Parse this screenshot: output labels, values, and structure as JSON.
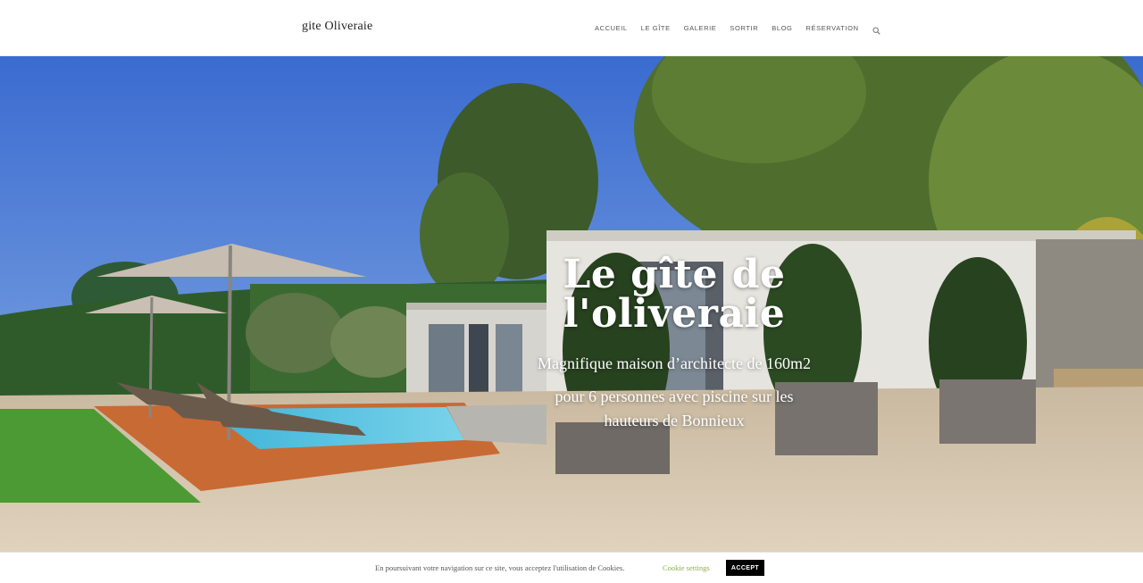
{
  "header": {
    "site_title": "gite Oliveraie",
    "nav": [
      {
        "label": "ACCUEIL"
      },
      {
        "label": "LE GÎTE"
      },
      {
        "label": "GALERIE"
      },
      {
        "label": "SORTIR"
      },
      {
        "label": "BLOG"
      },
      {
        "label": "RÉSERVATION"
      }
    ],
    "search_icon": "search-icon"
  },
  "hero": {
    "title_line1": "Le gîte de",
    "title_line2": "l'oliveraie",
    "subtitle_line1": "Magnifique maison d’architecte de 160m2",
    "subtitle_line2": "pour 6 personnes avec piscine  sur les",
    "subtitle_line3": "hauteurs de Bonnieux"
  },
  "cookie_bar": {
    "text": "En poursuivant votre navigation sur ce site, vous acceptez l'utilisation de Cookies.",
    "settings_label": "Cookie settings",
    "accept_label": "ACCEPT"
  },
  "colors": {
    "cookie_settings_link": "#8ab04a",
    "accept_button_bg": "#000000"
  }
}
